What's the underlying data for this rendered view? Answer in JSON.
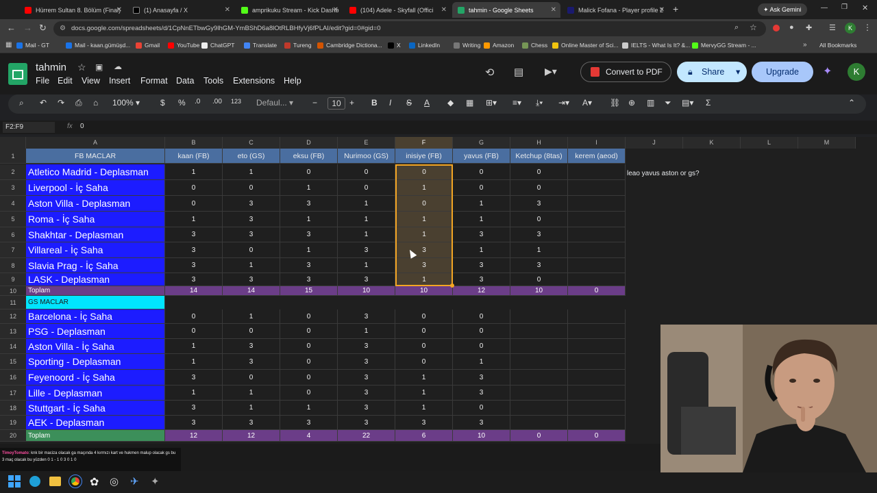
{
  "browser": {
    "tabs": [
      {
        "label": "Hürrem Sultan 8. Bölüm (Final)",
        "color": "#ff0000"
      },
      {
        "label": "(1) Anasayfa / X",
        "color": "#000000"
      },
      {
        "label": "amprikuku Stream - Kick Dashb",
        "color": "#53fc18"
      },
      {
        "label": "(104) Adele - Skyfall (Offici",
        "color": "#ff0000"
      },
      {
        "label": "tahmin - Google Sheets",
        "color": "#23a566"
      },
      {
        "label": "Malick Fofana - Player profile 2",
        "color": "#1a1a6e"
      }
    ],
    "ask_gemini": "Ask Gemini",
    "url": "docs.google.com/spreadsheets/d/1CpNnETbwGy9lhGM-YmBShD6a8lOtRLBHfyVj6fPLAI/edit?gid=0#gid=0",
    "bookmarks": [
      {
        "label": "Mail - GT",
        "color": "#1a73e8"
      },
      {
        "label": "Mail - kaan.gümüşd...",
        "color": "#1a73e8"
      },
      {
        "label": "Gmail",
        "color": "#ea4335"
      },
      {
        "label": "YouTube",
        "color": "#ff0000"
      },
      {
        "label": "ChatGPT",
        "color": "#eeeeee"
      },
      {
        "label": "Translate",
        "color": "#4285f4"
      },
      {
        "label": "Tureng",
        "color": "#c0392b"
      },
      {
        "label": "Cambridge Dictiona...",
        "color": "#d35400"
      },
      {
        "label": "X",
        "color": "#000000"
      },
      {
        "label": "LinkedIn",
        "color": "#0a66c2"
      },
      {
        "label": "Writing",
        "color": "#777777"
      },
      {
        "label": "Amazon",
        "color": "#ff9900"
      },
      {
        "label": "Chess",
        "color": "#769656"
      },
      {
        "label": "Online Master of Sci...",
        "color": "#f1c40f"
      },
      {
        "label": "IELTS - What Is It? &...",
        "color": "#cccccc"
      },
      {
        "label": "MervyGG Stream - ...",
        "color": "#53fc18"
      }
    ],
    "all_bookmarks": "All Bookmarks"
  },
  "sheets": {
    "title": "tahmin",
    "menu": [
      "File",
      "Edit",
      "View",
      "Insert",
      "Format",
      "Data",
      "Tools",
      "Extensions",
      "Help"
    ],
    "convert_pdf": "Convert to PDF",
    "share": "Share",
    "upgrade": "Upgrade",
    "avatar": "K",
    "zoom": "100%",
    "font": "Defaul...",
    "font_size": "10",
    "currency": "$",
    "percent": "%",
    "dec_less": ".0",
    "dec_more": ".00",
    "num_format": "123",
    "name_box": "F2:F9",
    "formula_value": "0",
    "side_note": "leao yavus aston or gs?"
  },
  "grid": {
    "columns": [
      "A",
      "B",
      "C",
      "D",
      "E",
      "F",
      "G",
      "H",
      "I",
      "J",
      "K",
      "L",
      "M"
    ],
    "header_row": [
      "FB MACLAR",
      "kaan (FB)",
      "eto (GS)",
      "eksu (FB)",
      "Nurimoo (GS)",
      "inisiye (FB)",
      "yavus (FB)",
      "Ketchup (8tas)",
      "kerem (aeod)"
    ],
    "fb_rows": [
      [
        "Atletico Madrid - Deplasman",
        "1",
        "1",
        "0",
        "0",
        "0",
        "0",
        "0",
        ""
      ],
      [
        "Liverpool - İç Saha",
        "0",
        "0",
        "1",
        "0",
        "1",
        "0",
        "0",
        ""
      ],
      [
        "Aston Villa - Deplasman",
        "0",
        "3",
        "3",
        "1",
        "0",
        "1",
        "3",
        ""
      ],
      [
        "Roma - İç Saha",
        "1",
        "3",
        "1",
        "1",
        "1",
        "1",
        "0",
        ""
      ],
      [
        "Shakhtar - Deplasman",
        "3",
        "3",
        "3",
        "1",
        "1",
        "3",
        "3",
        ""
      ],
      [
        "Villareal - İç Saha",
        "3",
        "0",
        "1",
        "3",
        "3",
        "1",
        "1",
        ""
      ],
      [
        "Slavia Prag - İç Saha",
        "3",
        "1",
        "3",
        "1",
        "3",
        "3",
        "3",
        ""
      ],
      [
        "LASK - Deplasman",
        "3",
        "3",
        "3",
        "3",
        "1",
        "3",
        "0",
        ""
      ]
    ],
    "fb_total": [
      "Toplam",
      "14",
      "14",
      "15",
      "10",
      "10",
      "12",
      "10",
      "0"
    ],
    "gs_header": "GS MACLAR",
    "gs_rows": [
      [
        "Barcelona - İç Saha",
        "0",
        "1",
        "0",
        "3",
        "0",
        "0",
        "",
        ""
      ],
      [
        "PSG - Deplasman",
        "0",
        "0",
        "0",
        "1",
        "0",
        "0",
        "",
        ""
      ],
      [
        "Aston Villa - İç Saha",
        "1",
        "3",
        "0",
        "3",
        "0",
        "0",
        "",
        ""
      ],
      [
        "Sporting - Deplasman",
        "1",
        "3",
        "0",
        "3",
        "0",
        "1",
        "",
        ""
      ],
      [
        "Feyenoord - İç Saha",
        "3",
        "0",
        "0",
        "3",
        "1",
        "3",
        "",
        ""
      ],
      [
        "Lille - Deplasman",
        "1",
        "1",
        "0",
        "3",
        "1",
        "3",
        "",
        ""
      ],
      [
        "Stuttgart - İç Saha",
        "3",
        "1",
        "1",
        "3",
        "1",
        "0",
        "",
        ""
      ],
      [
        "AEK - Deplasman",
        "3",
        "3",
        "3",
        "3",
        "3",
        "3",
        "",
        ""
      ]
    ],
    "gs_total": [
      "Toplam",
      "12",
      "12",
      "4",
      "22",
      "6",
      "10",
      "0",
      "0"
    ]
  },
  "chat": {
    "user": "TimoyTomato",
    "message": ": knk bir maciza olacak ga maçında 4 kırmızı kart ve hukmen malup olacak gs bu 3 maç olacak bu yüzden 0 1 - 1 0 3 0 1 0"
  },
  "colors": {
    "accent": "#8ab4f8",
    "row_blue": "#1c1cff",
    "header_blue": "#4a6ea0",
    "total_purple": "#6b3d88",
    "gs_cyan": "#00e5ff",
    "sheets_green": "#23a566"
  }
}
